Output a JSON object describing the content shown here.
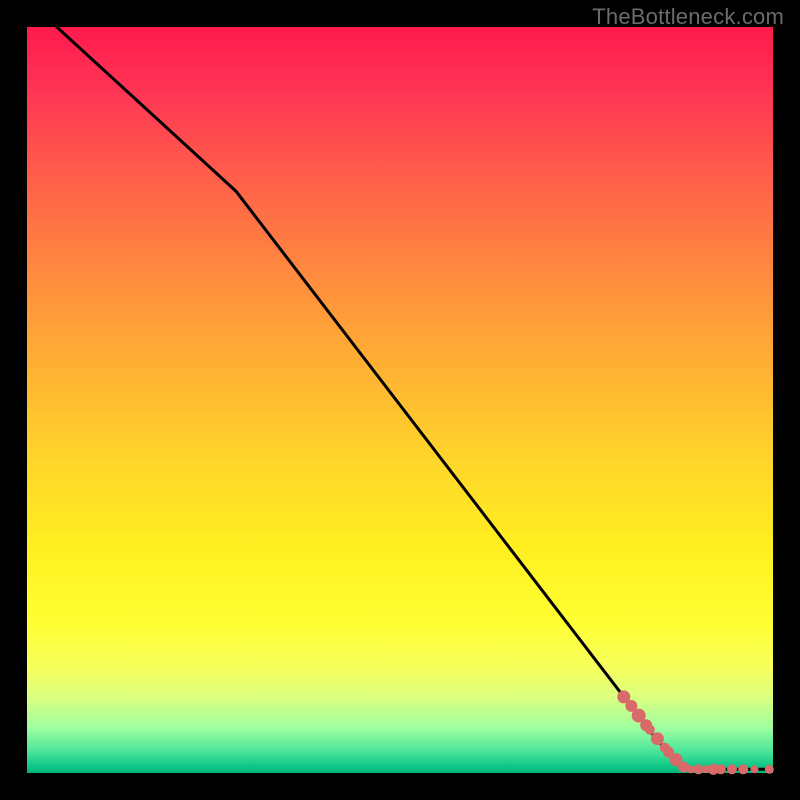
{
  "watermark": "TheBottleneck.com",
  "colors": {
    "background": "#000000",
    "line": "#000000",
    "marker": "#d96a6a",
    "gradient_top": "#ff1a4d",
    "gradient_bottom": "#00b37a"
  },
  "chart_data": {
    "type": "line",
    "title": "",
    "xlabel": "",
    "ylabel": "",
    "xlim": [
      0,
      100
    ],
    "ylim": [
      0,
      100
    ],
    "grid": false,
    "legend": false,
    "series": [
      {
        "name": "curve",
        "x": [
          4,
          28,
          84,
          88,
          100
        ],
        "y": [
          100,
          78,
          5,
          0.5,
          0.5
        ]
      }
    ],
    "markers": {
      "name": "points",
      "style": "circle",
      "color": "#d96a6a",
      "radius_range": [
        3.5,
        7
      ],
      "x": [
        80,
        81,
        82,
        83,
        83.5,
        84.5,
        85.5,
        86,
        87,
        88,
        89,
        90,
        91,
        92,
        93,
        94.5,
        96,
        97.5,
        99.5
      ],
      "y": [
        10.2,
        9.0,
        7.7,
        6.4,
        5.8,
        4.6,
        3.4,
        2.8,
        1.8,
        0.8,
        0.5,
        0.5,
        0.5,
        0.5,
        0.5,
        0.5,
        0.5,
        0.5,
        0.5
      ],
      "r": [
        6.5,
        6,
        7,
        6,
        5,
        6.5,
        5,
        5.5,
        6.5,
        5.5,
        4,
        5,
        4,
        5.5,
        5,
        5,
        5,
        4,
        4.5
      ]
    }
  }
}
